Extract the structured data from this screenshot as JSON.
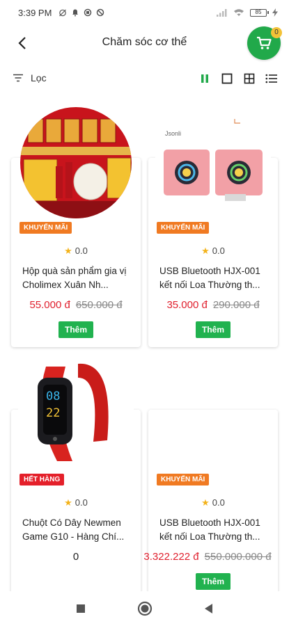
{
  "status": {
    "time": "3:39 PM",
    "battery": "85"
  },
  "header": {
    "title": "Chăm sóc cơ thể",
    "cart_count": "0"
  },
  "filter": {
    "label": "Lọc"
  },
  "colors": {
    "brand_green": "#21a94a",
    "price_red": "#e0202e",
    "promo_orange": "#f07a22",
    "soldout_red": "#e4202a"
  },
  "products": [
    {
      "tag": "KHUYẾN MÃI",
      "rating": "0.0",
      "name": "Hộp quà sản phẩm gia vị Cholimex Xuân Nh...",
      "price": "55.000 đ",
      "old_price": "650.000 đ",
      "add_label": "Thêm",
      "image": "gift-box-image"
    },
    {
      "tag": "KHUYẾN MÃI",
      "rating": "0.0",
      "name": "USB Bluetooth HJX-001 kết nối Loa Thường th...",
      "price": "35.000 đ",
      "old_price": "290.000 đ",
      "add_label": "Thêm",
      "image": "pink-speakers-image",
      "image_text": "Jsonli"
    },
    {
      "tag": "HẾT HÀNG",
      "rating": "0.0",
      "name": "Chuột Có Dây Newmen Game G10 - Hàng Chí...",
      "price": "0",
      "image": "smart-band-image",
      "image_text": [
        "08",
        "22"
      ]
    },
    {
      "tag": "KHUYẾN MÃI",
      "rating": "0.0",
      "name": "USB Bluetooth HJX-001 kết nối Loa Thường th...",
      "price": "3.322.222 đ",
      "old_price": "550.000.000 đ",
      "add_label": "Thêm"
    }
  ]
}
